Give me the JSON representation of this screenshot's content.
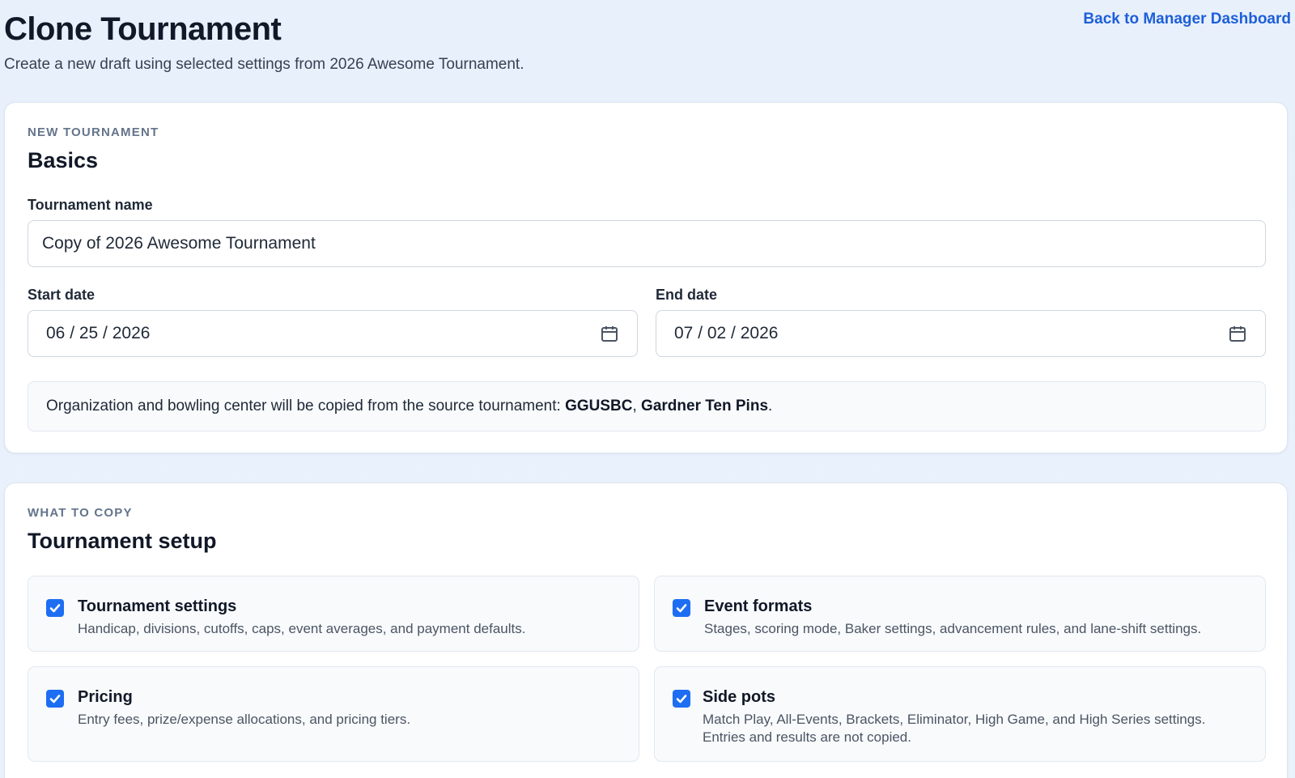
{
  "header": {
    "title": "Clone Tournament",
    "subtitle": "Create a new draft using selected settings from 2026 Awesome Tournament.",
    "back_link": "Back to Manager Dashboard"
  },
  "basics": {
    "eyebrow": "NEW TOURNAMENT",
    "heading": "Basics",
    "name_label": "Tournament name",
    "name_value": "Copy of 2026 Awesome Tournament",
    "start_label": "Start date",
    "start_value": "06 / 25 / 2026",
    "end_label": "End date",
    "end_value": "07 / 02 / 2026",
    "notice_prefix": "Organization and bowling center will be copied from the source tournament: ",
    "notice_org": "GGUSBC",
    "notice_sep": ", ",
    "notice_center": "Gardner Ten Pins",
    "notice_suffix": "."
  },
  "copy": {
    "eyebrow": "WHAT TO COPY",
    "heading": "Tournament setup",
    "options": [
      {
        "title": "Tournament settings",
        "desc": "Handicap, divisions, cutoffs, caps, event averages, and payment defaults.",
        "checked": true
      },
      {
        "title": "Event formats",
        "desc": "Stages, scoring mode, Baker settings, advancement rules, and lane-shift settings.",
        "checked": true
      },
      {
        "title": "Pricing",
        "desc": "Entry fees, prize/expense allocations, and pricing tiers.",
        "checked": true
      },
      {
        "title": "Side pots",
        "desc": "Match Play, All-Events, Brackets, Eliminator, High Game, and High Series settings. Entries and results are not copied.",
        "checked": true
      }
    ]
  },
  "colors": {
    "accent": "#1d6ef2",
    "link": "#1d5fd8",
    "background": "#e8f0fc"
  },
  "icons": {
    "calendar": "calendar-icon",
    "check": "checkmark-icon"
  }
}
